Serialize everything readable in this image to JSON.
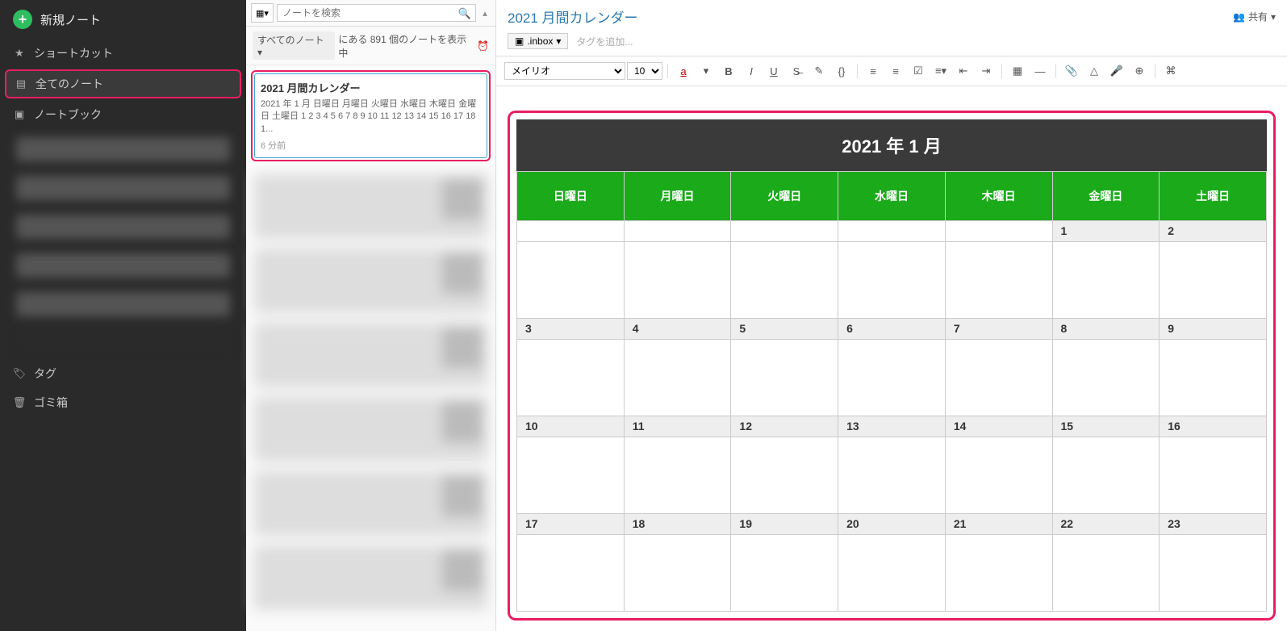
{
  "sidebar": {
    "new_note": "新規ノート",
    "shortcuts": "ショートカット",
    "all_notes": "全てのノート",
    "notebooks": "ノートブック",
    "tags": "タグ",
    "trash": "ゴミ箱"
  },
  "notelist": {
    "search_placeholder": "ノートを検索",
    "filter_label": "すべてのノート",
    "filter_suffix": "にある 891 個のノートを表示中",
    "selected": {
      "title": "2021 月間カレンダー",
      "preview": "2021 年 1 月 日曜日 月曜日 火曜日 水曜日 木曜日 金曜日 土曜日 1 2 3 4 5 6 7 8 9 10 11 12 13 14 15 16 17 18 1...",
      "time": "6 分前"
    }
  },
  "editor": {
    "title": "2021 月間カレンダー",
    "share": "共有",
    "notebook": ".inbox",
    "add_tag": "タグを追加...",
    "font": "メイリオ",
    "font_size": "10"
  },
  "calendar": {
    "title": "2021 年 1 月",
    "weekdays": [
      "日曜日",
      "月曜日",
      "火曜日",
      "水曜日",
      "木曜日",
      "金曜日",
      "土曜日"
    ],
    "weeks": [
      [
        "",
        "",
        "",
        "",
        "",
        "1",
        "2"
      ],
      [
        "3",
        "4",
        "5",
        "6",
        "7",
        "8",
        "9"
      ],
      [
        "10",
        "11",
        "12",
        "13",
        "14",
        "15",
        "16"
      ],
      [
        "17",
        "18",
        "19",
        "20",
        "21",
        "22",
        "23"
      ]
    ]
  }
}
